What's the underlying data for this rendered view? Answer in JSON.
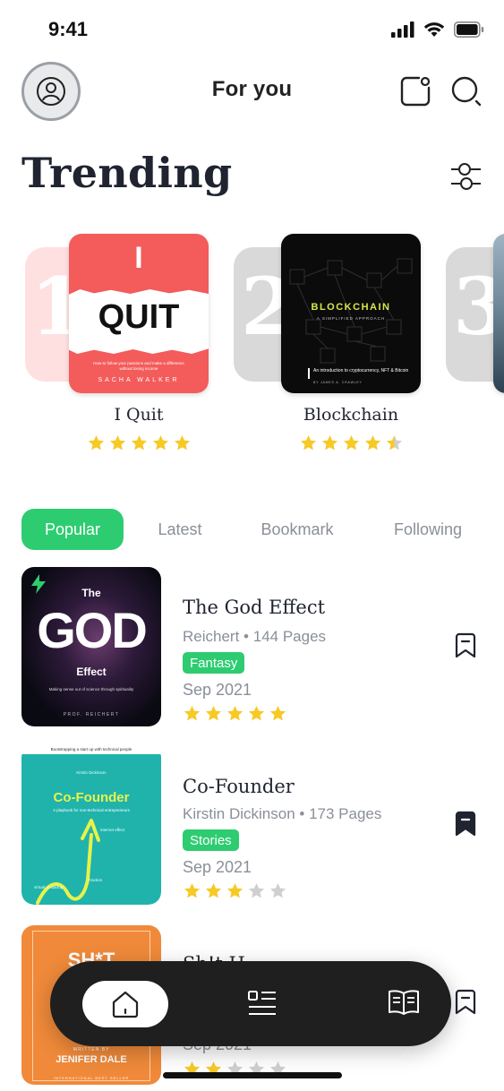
{
  "status": {
    "time": "9:41"
  },
  "header": {
    "title": "For you"
  },
  "trending": {
    "title": "Trending",
    "items": [
      {
        "rank": "1",
        "title": "I Quit",
        "rating": 5,
        "cover": {
          "line1": "I",
          "line2": "QUIT",
          "subtitle": "How to follow your passions and make a difference without losing income",
          "author": "SACHA WALKER"
        }
      },
      {
        "rank": "2",
        "title": "Blockchain",
        "rating": 4.5,
        "cover": {
          "line1": "BLOCKCHAIN",
          "line2": "A SIMPLIFIED APPROACH",
          "subtitle": "An introduction to cryptocurrency, NFT & Bitcoin",
          "author": "BY JAMES A. CRAWLEY"
        }
      },
      {
        "rank": "3"
      }
    ]
  },
  "tabs": [
    {
      "label": "Popular",
      "active": true
    },
    {
      "label": "Latest",
      "active": false
    },
    {
      "label": "Bookmark",
      "active": false
    },
    {
      "label": "Following",
      "active": false
    }
  ],
  "books": [
    {
      "title": "The God Effect",
      "author": "Reichert",
      "pages": "144 Pages",
      "tag": "Fantasy",
      "date": "Sep 2021",
      "rating": 5,
      "bookmarked": false,
      "cover": {
        "top": "The",
        "main": "GOD",
        "sub": "Effect",
        "tagline": "Making sense out of science through spirituality",
        "author": "PROF. REICHERT"
      }
    },
    {
      "title": "Co-Founder",
      "author": "Kirstin Dickinson",
      "pages": "173 Pages",
      "tag": "Stories",
      "date": "Sep 2021",
      "rating": 3,
      "bookmarked": true,
      "cover": {
        "top": "Bootstrapping a start up with technical people",
        "author": "Kirstin Dickinson",
        "main": "Co-Founder",
        "sub": "A playbook for non-technical entrepreneurs",
        "note1": "internet effect",
        "note2": "Traction",
        "note3": "virtual or startup"
      }
    },
    {
      "title": "Sh!t H",
      "date": "Sep 2021",
      "rating": 2,
      "bookmarked": false,
      "cover": {
        "main": "SH*T",
        "writtenby": "WRITTEN BY",
        "author": "JENIFER DALE",
        "footer": "INTERNATIONAL BEST SELLER"
      }
    }
  ],
  "colors": {
    "accent": "#2ecc71",
    "star": "#f7c926",
    "star_empty": "#cfcfcf",
    "dark": "#1f2430"
  },
  "nav": {
    "items": [
      "home-icon",
      "list-icon",
      "book-open-icon"
    ]
  }
}
